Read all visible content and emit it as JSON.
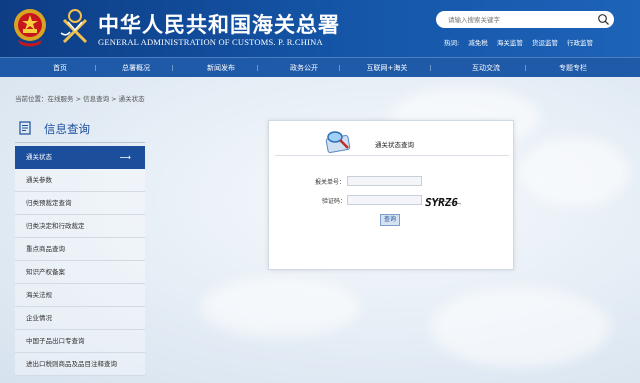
{
  "header": {
    "title": "中华人民共和国海关总署",
    "subtitle": "GENERAL ADMINISTRATION OF CUSTOMS. P. R.CHINA",
    "search_placeholder": "请输入搜索关键字",
    "hot_links": [
      "热词:",
      "减免税",
      "海关监管",
      "货运监管",
      "行政监管"
    ]
  },
  "nav": [
    "首页",
    "总署概况",
    "新闻发布",
    "政务公开",
    "互联网+海关",
    "互动交流",
    "专题专栏"
  ],
  "breadcrumb": "当前位置：在线服务 > 信息查询 > 通关状态",
  "sidebar": {
    "title": "信息查询",
    "items": [
      "通关状态",
      "通关参数",
      "归类预裁定查询",
      "归类决定和行政裁定",
      "重点商品查询",
      "知识产权备案",
      "海关法规",
      "企业情况",
      "中国子品出口专查询",
      "进出口税则商品及品目注释查询"
    ]
  },
  "panel": {
    "title": "通关状态查询",
    "field_labels": [
      "报关单号：",
      "验证码："
    ],
    "captcha": "SYRZ6",
    "button": "查询"
  },
  "colors": {
    "header_blue": "#0d3d85",
    "nav_blue": "#1f5aa9",
    "active_blue": "#1b4e9b"
  }
}
